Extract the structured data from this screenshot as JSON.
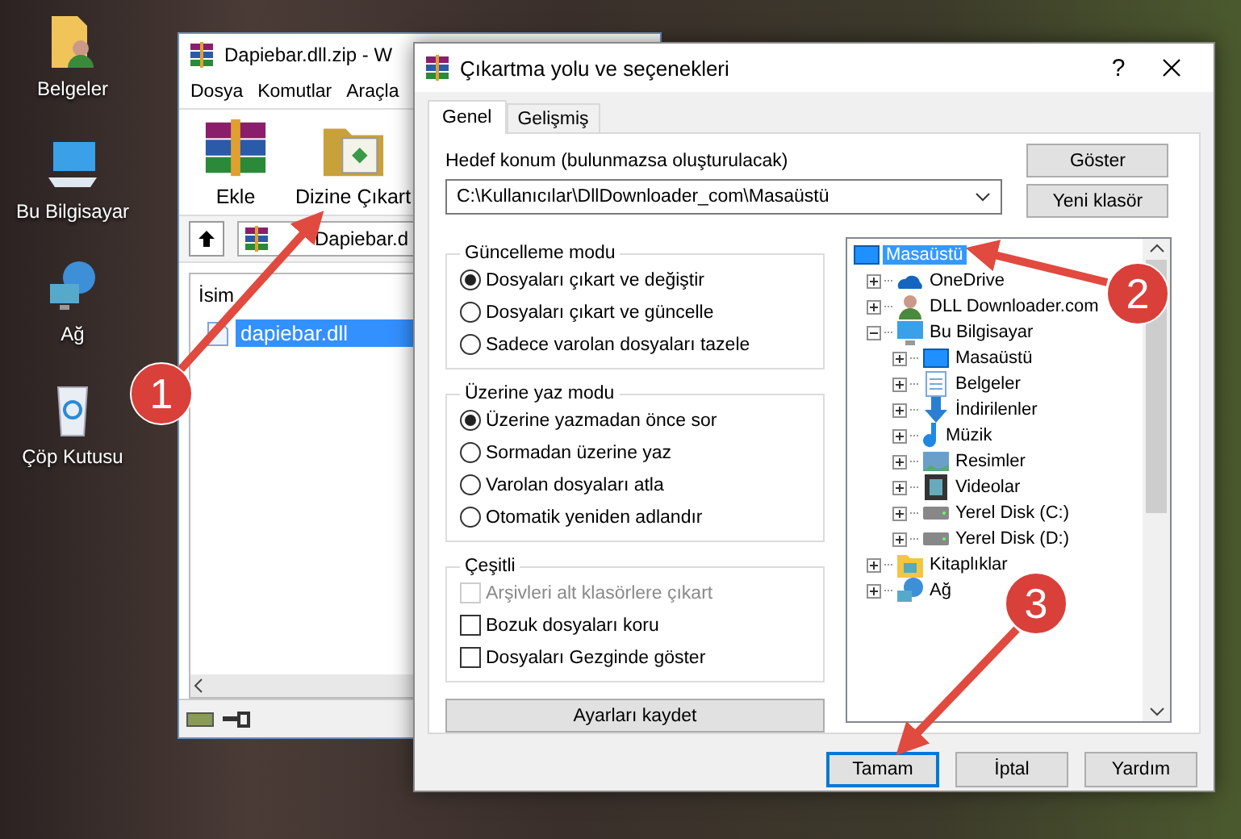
{
  "desktop_icons": [
    {
      "label": "Belgeler",
      "kind": "documents"
    },
    {
      "label": "Bu Bilgisayar",
      "kind": "computer"
    },
    {
      "label": "Ağ",
      "kind": "network"
    },
    {
      "label": "Çöp Kutusu",
      "kind": "recycle"
    }
  ],
  "archiver_window": {
    "title": "Dapiebar.dll.zip - W",
    "menu": [
      "Dosya",
      "Komutlar",
      "Araçla"
    ],
    "toolbar": [
      {
        "label": "Ekle",
        "kind": "add"
      },
      {
        "label": "Dizine Çıkart",
        "kind": "extract"
      }
    ],
    "path": "Dapiebar.d",
    "columns": [
      "İsim"
    ],
    "files": [
      {
        "name": "dapiebar.dll",
        "selected": true
      }
    ]
  },
  "dialog": {
    "title": "Çıkartma yolu ve seçenekleri",
    "help": "?",
    "tabs": [
      {
        "label": "Genel",
        "selected": true
      },
      {
        "label": "Gelişmiş",
        "selected": false
      }
    ],
    "destination": {
      "label": "Hedef konum (bulunmazsa oluşturulacak)",
      "value": "C:\\Kullanıcılar\\DllDownloader_com\\Masaüstü"
    },
    "side_buttons": [
      "Göster",
      "Yeni klasör"
    ],
    "groups": [
      {
        "title": "Güncelleme modu",
        "options": [
          {
            "label": "Dosyaları çıkart ve değiştir",
            "kind": "radio",
            "selected": true
          },
          {
            "label": "Dosyaları çıkart ve güncelle",
            "kind": "radio",
            "selected": false
          },
          {
            "label": "Sadece varolan dosyaları tazele",
            "kind": "radio",
            "selected": false
          }
        ]
      },
      {
        "title": "Üzerine yaz modu",
        "options": [
          {
            "label": "Üzerine yazmadan önce sor",
            "kind": "radio",
            "selected": true
          },
          {
            "label": "Sormadan üzerine yaz",
            "kind": "radio",
            "selected": false
          },
          {
            "label": "Varolan dosyaları atla",
            "kind": "radio",
            "selected": false
          },
          {
            "label": "Otomatik yeniden adlandır",
            "kind": "radio",
            "selected": false
          }
        ]
      },
      {
        "title": "Çeşitli",
        "options": [
          {
            "label": "Arşivleri alt klasörlere çıkart",
            "kind": "checkbox",
            "checked": false,
            "disabled": true
          },
          {
            "label": "Bozuk dosyaları koru",
            "kind": "checkbox",
            "checked": false,
            "disabled": false
          },
          {
            "label": "Dosyaları Gezginde göster",
            "kind": "checkbox",
            "checked": false,
            "disabled": false
          }
        ]
      }
    ],
    "save_button": "Ayarları kaydet",
    "folder_tree": [
      {
        "label": "Masaüstü",
        "kind": "desktop",
        "selected": true,
        "children": [
          {
            "label": "OneDrive",
            "kind": "cloud",
            "selected": false,
            "expanded": false
          },
          {
            "label": "DLL Downloader.com",
            "kind": "user",
            "selected": false,
            "expanded": false
          },
          {
            "label": "Bu Bilgisayar",
            "kind": "computer",
            "selected": false,
            "expanded": true,
            "children": [
              {
                "label": "Masaüstü",
                "kind": "desktop",
                "selected": false,
                "expanded": false
              },
              {
                "label": "Belgeler",
                "kind": "document",
                "selected": false,
                "expanded": false
              },
              {
                "label": "İndirilenler",
                "kind": "download",
                "selected": false,
                "expanded": false
              },
              {
                "label": "Müzik",
                "kind": "music",
                "selected": false,
                "expanded": false
              },
              {
                "label": "Resimler",
                "kind": "picture",
                "selected": false,
                "expanded": false
              },
              {
                "label": "Videolar",
                "kind": "video",
                "selected": false,
                "expanded": false
              },
              {
                "label": "Yerel Disk (C:)",
                "kind": "drive",
                "selected": false,
                "expanded": false
              },
              {
                "label": "Yerel Disk (D:)",
                "kind": "drive",
                "selected": false,
                "expanded": false
              }
            ]
          },
          {
            "label": "Kitaplıklar",
            "kind": "library",
            "selected": false,
            "expanded": false
          },
          {
            "label": "Ağ",
            "kind": "network",
            "selected": false,
            "expanded": false
          }
        ]
      }
    ],
    "buttons": [
      {
        "label": "Tamam",
        "default": true
      },
      {
        "label": "İptal",
        "default": false
      },
      {
        "label": "Yardım",
        "default": false
      }
    ]
  },
  "annotations": [
    {
      "number": "1"
    },
    {
      "number": "2"
    },
    {
      "number": "3"
    }
  ]
}
